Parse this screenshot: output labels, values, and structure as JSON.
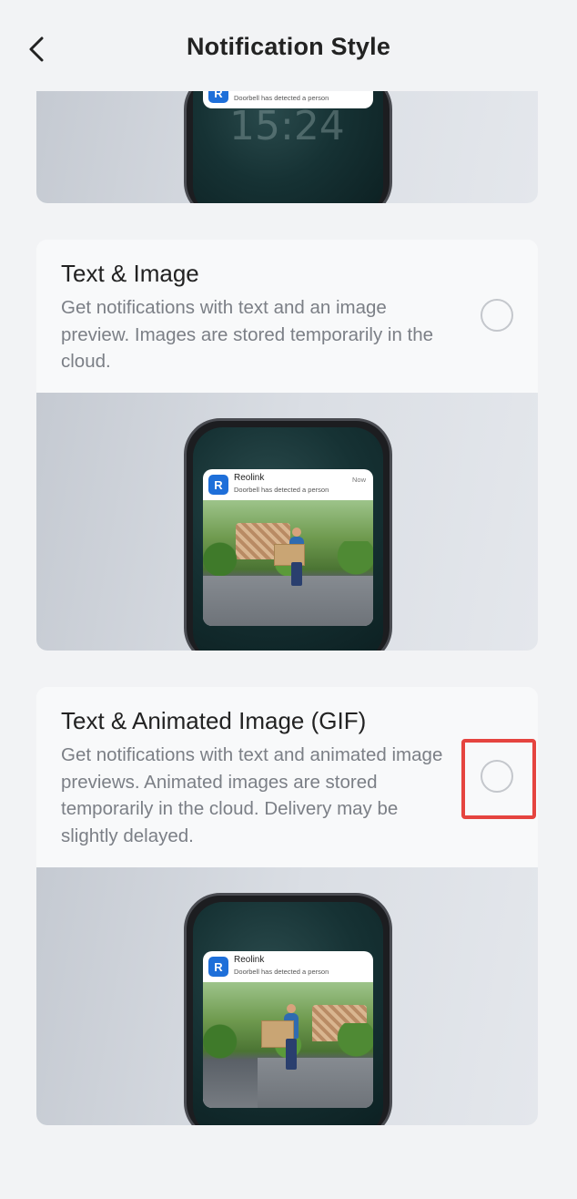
{
  "header": {
    "title": "Notification Style",
    "back_icon": "chevron-left-icon"
  },
  "notification": {
    "app_name": "Reolink",
    "app_icon_letter": "R",
    "message": "Doorbell has detected a person",
    "time": "Now"
  },
  "options": [
    {
      "title": "Text & Image",
      "description": "Get notifications with text and an image preview. Images are stored temporarily in the cloud.",
      "selected": false
    },
    {
      "title": "Text & Animated Image (GIF)",
      "description": "Get notifications with text and animated image previews. Animated images are stored temporarily in the cloud. Delivery may be slightly delayed.",
      "selected": false
    }
  ],
  "colors": {
    "background": "#f2f3f5",
    "accent_highlight": "#e5443f",
    "app_icon": "#1e6fd9",
    "radio_border": "#c4c7cc"
  }
}
